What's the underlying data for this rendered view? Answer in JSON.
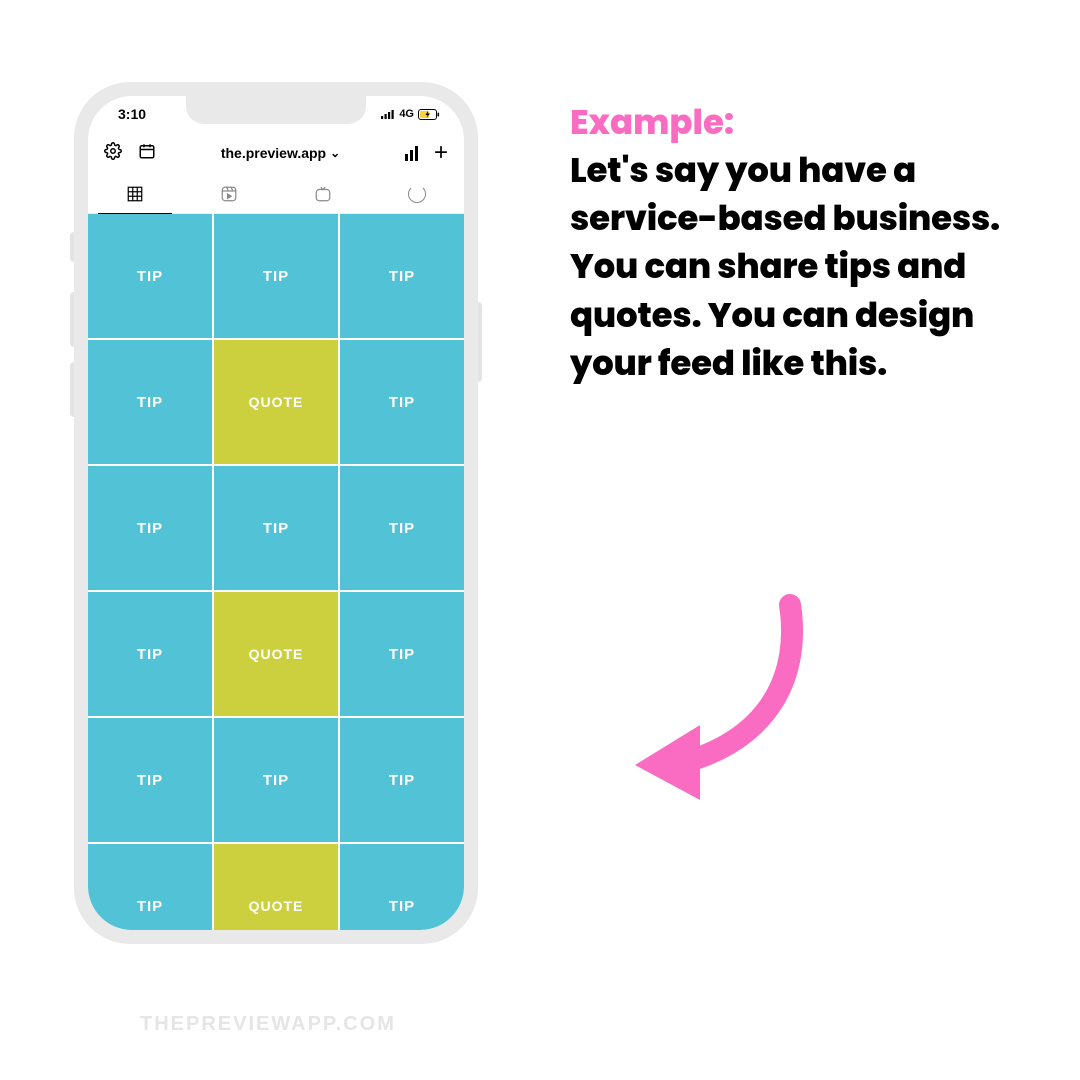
{
  "status": {
    "time": "3:10",
    "network": "4G"
  },
  "toolbar": {
    "title": "the.preview.app"
  },
  "grid": {
    "tip": "TIP",
    "quote": "QUOTE",
    "layout": [
      "tip",
      "tip",
      "tip",
      "tip",
      "quote",
      "tip",
      "tip",
      "tip",
      "tip",
      "tip",
      "quote",
      "tip",
      "tip",
      "tip",
      "tip",
      "tip",
      "quote",
      "tip"
    ]
  },
  "text": {
    "heading": "Example:",
    "body": "Let's say you have a service-based business. You can share tips and quotes. You can design your feed like this."
  },
  "watermark": "THEPREVIEWAPP.COM",
  "colors": {
    "accent_pink": "#fa6cc2",
    "tile_teal": "#52c3d6",
    "tile_olive": "#cccf3e"
  }
}
